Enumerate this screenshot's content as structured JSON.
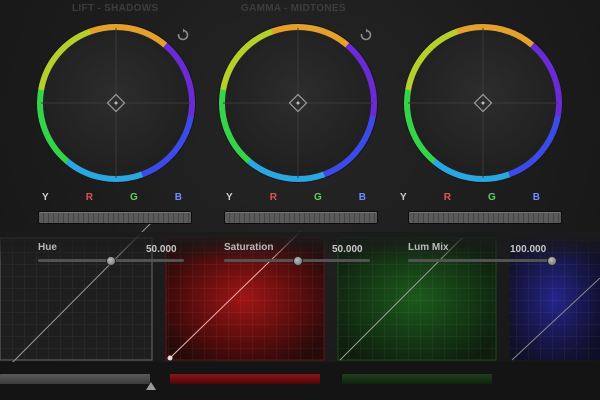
{
  "wheels": [
    {
      "title": "LIFT - SHADOWS",
      "channels": [
        "Y",
        "R",
        "G",
        "B"
      ],
      "has_reset": true
    },
    {
      "title": "GAMMA - MIDTONES",
      "channels": [
        "Y",
        "R",
        "G",
        "B"
      ],
      "has_reset": true
    },
    {
      "title": "",
      "channels": [
        "Y",
        "R",
        "G",
        "B"
      ],
      "has_reset": false
    }
  ],
  "params": [
    {
      "label": "Hue",
      "value": "50.000",
      "level": 0.5
    },
    {
      "label": "Saturation",
      "value": "50.000",
      "level": 0.5
    },
    {
      "label": "Lum Mix",
      "value": "100.000",
      "level": 1.0
    }
  ],
  "curves": [
    {
      "channel": "master",
      "color": "#9a9a9a"
    },
    {
      "channel": "red",
      "color": "#d11a1a"
    },
    {
      "channel": "green",
      "color": "#22b022"
    },
    {
      "channel": "blue",
      "color": "#2a2acc"
    }
  ],
  "icons": {
    "reset": "reset-icon",
    "crosshair": "crosshair-icon"
  }
}
